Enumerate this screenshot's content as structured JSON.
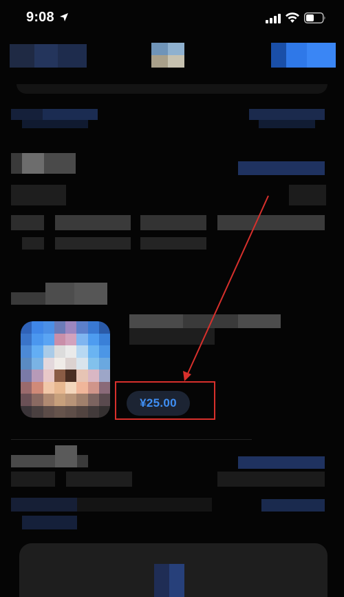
{
  "status_bar": {
    "time": "9:08"
  },
  "icons": {
    "location": "location-arrow-icon",
    "signal": "cellular-signal-icon",
    "wifi": "wifi-icon",
    "battery": "battery-icon"
  },
  "purchase": {
    "price": "¥25.00"
  },
  "colors": {
    "background": "#050505",
    "accent": "#3f8ff4",
    "price_pill": "#1c2433",
    "annotation": "#d8302c"
  }
}
